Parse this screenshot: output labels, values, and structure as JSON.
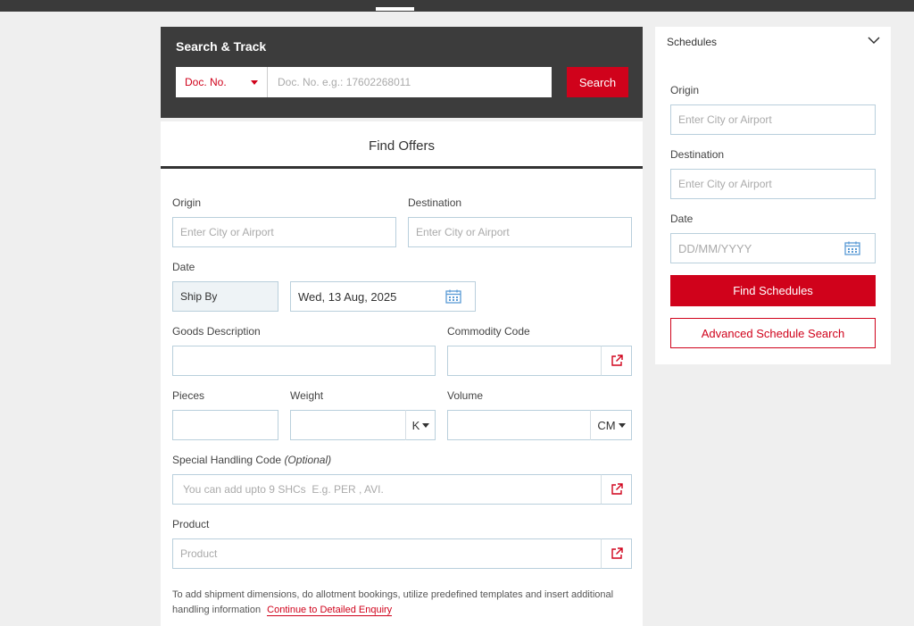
{
  "search_track": {
    "title": "Search & Track",
    "doc_type": "Doc. No.",
    "doc_placeholder": "Doc. No. e.g.: 17602268011",
    "search_label": "Search"
  },
  "offers": {
    "title": "Find Offers",
    "origin_label": "Origin",
    "origin_placeholder": "Enter City or Airport",
    "destination_label": "Destination",
    "destination_placeholder": "Enter City or Airport",
    "date_label": "Date",
    "ship_by": "Ship By",
    "date_value": "Wed, 13 Aug, 2025",
    "goods_label": "Goods Description",
    "commodity_label": "Commodity Code",
    "pieces_label": "Pieces",
    "weight_label": "Weight",
    "weight_unit": "K",
    "volume_label": "Volume",
    "volume_unit": "CM",
    "shc_label": "Special Handling Code",
    "shc_optional": "(Optional)",
    "shc_placeholder": "You can add upto 9 SHCs  E.g. PER , AVI.",
    "product_label": "Product",
    "product_placeholder": "Product",
    "note_text": "To add shipment dimensions, do allotment bookings, utilize predefined templates and insert additional handling information",
    "note_link": "Continue to Detailed Enquiry"
  },
  "schedules": {
    "title": "Schedules",
    "origin_label": "Origin",
    "origin_placeholder": "Enter City or Airport",
    "destination_label": "Destination",
    "destination_placeholder": "Enter City or Airport",
    "date_label": "Date",
    "date_placeholder": "DD/MM/YYYY",
    "find_label": "Find Schedules",
    "advanced_label": "Advanced Schedule Search"
  },
  "colors": {
    "accent": "#d0021b",
    "dark": "#3c3c3c",
    "border": "#b9cfdc"
  }
}
